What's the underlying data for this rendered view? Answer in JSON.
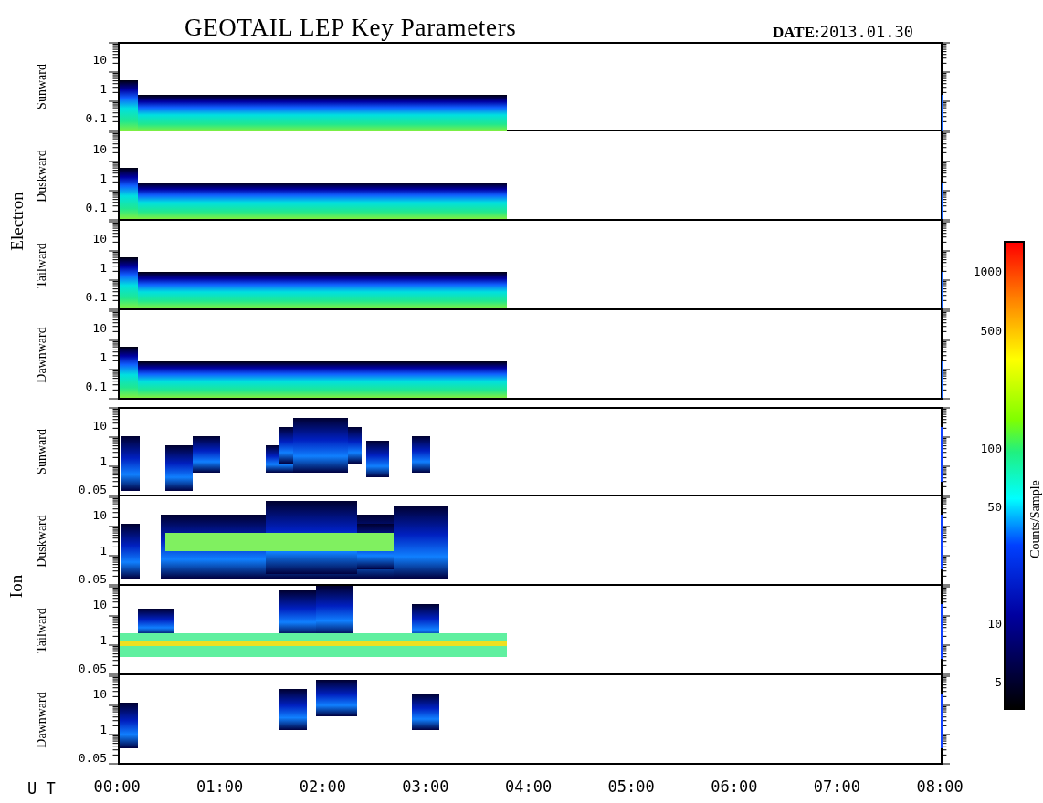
{
  "title": "GEOTAIL LEP Key Parameters",
  "date": {
    "label": "DATE:",
    "value": "2013.01.30"
  },
  "groups": [
    {
      "name": "Electron",
      "kind": "electron",
      "panels": [
        {
          "label": "Sunward",
          "yticks": [
            "10",
            "1",
            "0.1"
          ]
        },
        {
          "label": "Duskward",
          "yticks": [
            "10",
            "1",
            "0.1"
          ]
        },
        {
          "label": "Tailward",
          "yticks": [
            "10",
            "1",
            "0.1"
          ]
        },
        {
          "label": "Dawnward",
          "yticks": [
            "10",
            "1",
            "0.1"
          ]
        }
      ]
    },
    {
      "name": "Ion",
      "kind": "ion",
      "panels": [
        {
          "label": "Sunward",
          "yticks": [
            "10",
            "1",
            "0.05"
          ]
        },
        {
          "label": "Duskward",
          "yticks": [
            "10",
            "1",
            "0.05"
          ]
        },
        {
          "label": "Tailward",
          "yticks": [
            "10",
            "1",
            "0.05"
          ]
        },
        {
          "label": "Dawnward",
          "yticks": [
            "10",
            "1",
            "0.05"
          ]
        }
      ]
    }
  ],
  "x_axis": {
    "label": "U T",
    "ticks": [
      "00:00",
      "01:00",
      "02:00",
      "03:00",
      "04:00",
      "05:00",
      "06:00",
      "07:00",
      "08:00"
    ]
  },
  "colorbar": {
    "title": "Counts/Sample",
    "ticks": [
      "1000",
      "500",
      "100",
      "50",
      "10",
      "5"
    ]
  }
}
